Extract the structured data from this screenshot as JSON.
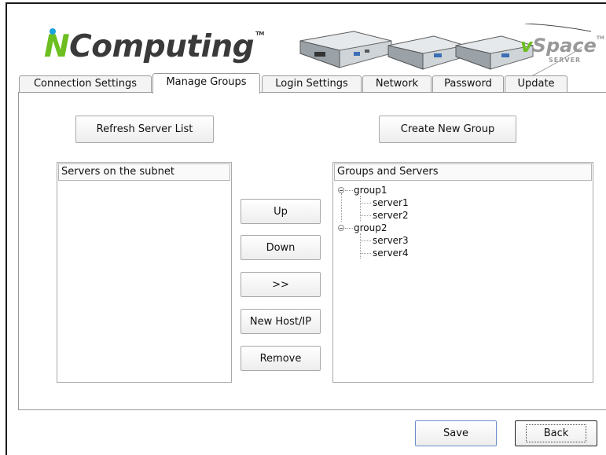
{
  "header": {
    "brand_letter": "N",
    "brand_rest": "Computing",
    "brand_tm": "TM",
    "product_letter": "v",
    "product_rest": "Space",
    "product_tm": "TM",
    "product_sub": "SERVER",
    "colors": {
      "green": "#6cbf1f",
      "blue": "#1aa3dc",
      "gray": "#3a3a3a"
    }
  },
  "tabs": [
    {
      "label": "Connection Settings"
    },
    {
      "label": "Manage Groups",
      "active": true
    },
    {
      "label": "Login Settings"
    },
    {
      "label": "Network"
    },
    {
      "label": "Password"
    },
    {
      "label": "Update"
    }
  ],
  "buttons": {
    "refresh": "Refresh Server List",
    "create_group": "Create New Group",
    "up": "Up",
    "down": "Down",
    "move": ">>",
    "new_host": "New Host/IP",
    "remove": "Remove",
    "save": "Save",
    "back": "Back"
  },
  "servers_list": {
    "header": "Servers on the subnet",
    "items": []
  },
  "groups_tree": {
    "header": "Groups and Servers",
    "groups": [
      {
        "name": "group1",
        "expanded": true,
        "servers": [
          "server1",
          "server2"
        ]
      },
      {
        "name": "group2",
        "expanded": true,
        "servers": [
          "server3",
          "server4"
        ]
      }
    ]
  }
}
